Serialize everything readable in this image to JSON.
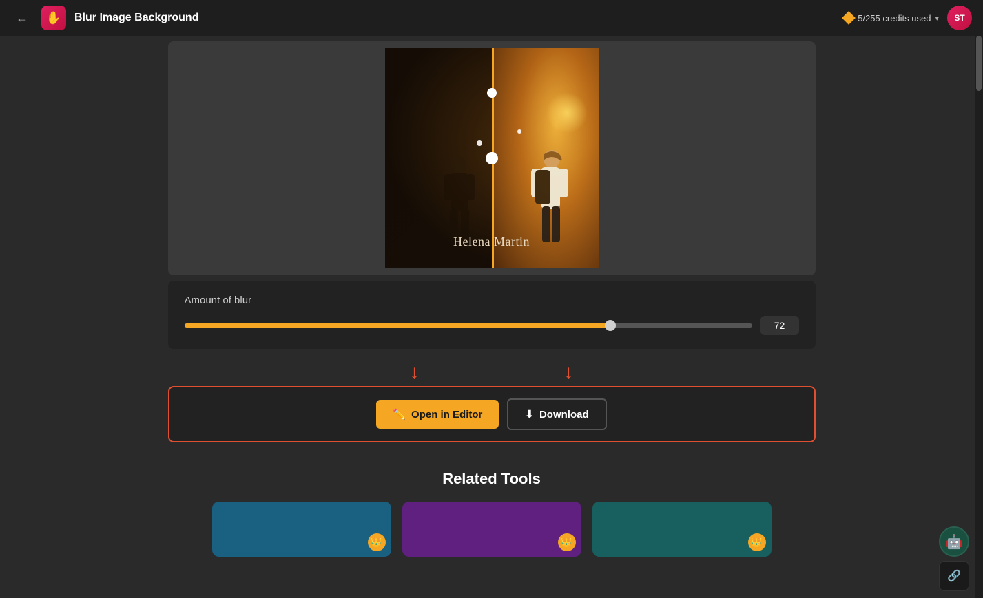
{
  "header": {
    "back_label": "←",
    "logo_emoji": "✋",
    "title": "Blur Image Background",
    "credits_text": "5/255 credits used",
    "avatar_initials": "ST"
  },
  "preview": {
    "photo_caption": "Helena Martin",
    "image_alt": "Woman with backpack photo with blur comparison"
  },
  "controls": {
    "blur_label": "Amount of blur",
    "slider_value": "72",
    "slider_fill_percent": 75
  },
  "actions": {
    "open_editor_label": "Open in Editor",
    "download_label": "Download"
  },
  "related": {
    "title": "Related Tools"
  },
  "bot": {
    "emoji": "🤖"
  },
  "link": {
    "emoji": "🔗"
  }
}
